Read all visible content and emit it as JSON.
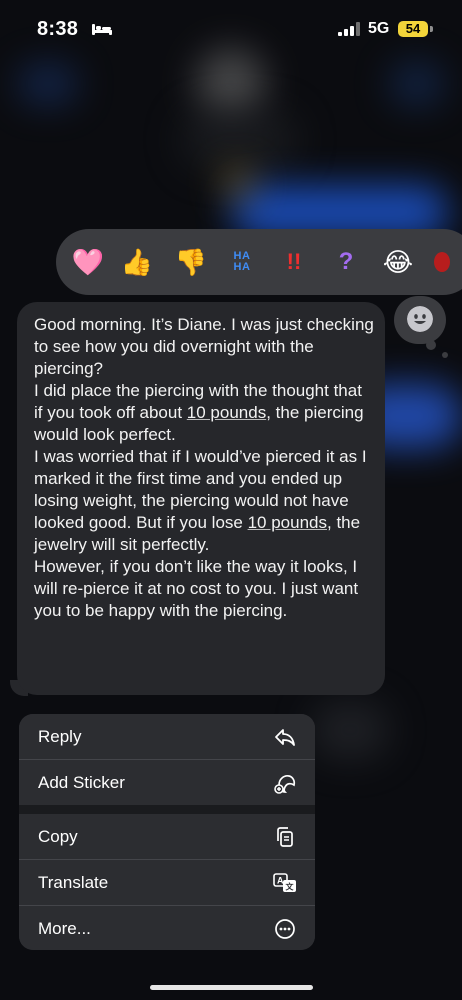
{
  "status_bar": {
    "time": "8:38",
    "network": "5G",
    "battery_level": "54",
    "battery_color": "#f2d43a"
  },
  "reactions": [
    {
      "name": "heart-reaction",
      "emoji": "🩷"
    },
    {
      "name": "thumbs-up-reaction",
      "emoji": "👍"
    },
    {
      "name": "thumbs-down-reaction",
      "emoji": "👎"
    },
    {
      "name": "haha-reaction",
      "text": "HA HA"
    },
    {
      "name": "exclamation-reaction",
      "text": "!!"
    },
    {
      "name": "question-reaction",
      "text": "?"
    },
    {
      "name": "laughing-reaction",
      "emoji": "😂"
    }
  ],
  "message": {
    "p1": "Good morning. It’s Diane. I was just checking to see how you did overnight with the piercing?",
    "p2_a": "I did place the piercing with the thought that if you took off about ",
    "p2_link": "10 pounds",
    "p2_b": ", the piercing would look perfect.",
    "p3_a": "I was worried that if I would’ve pierced it as I marked it the first time and you ended up losing weight, the piercing would not have looked good. But if you lose ",
    "p3_link": "10 pounds",
    "p3_b": ", the jewelry will sit perfectly.",
    "p4": "However, if you don’t like the way it looks, I will re-pierce it at no cost to you. I just want you to be happy with the piercing."
  },
  "menu": {
    "reply": "Reply",
    "add_sticker": "Add Sticker",
    "copy": "Copy",
    "translate": "Translate",
    "more": "More..."
  },
  "colors": {
    "bubble": "#26272b",
    "menu": "#2c2d31",
    "reaction_bar": "#3b3c40"
  }
}
